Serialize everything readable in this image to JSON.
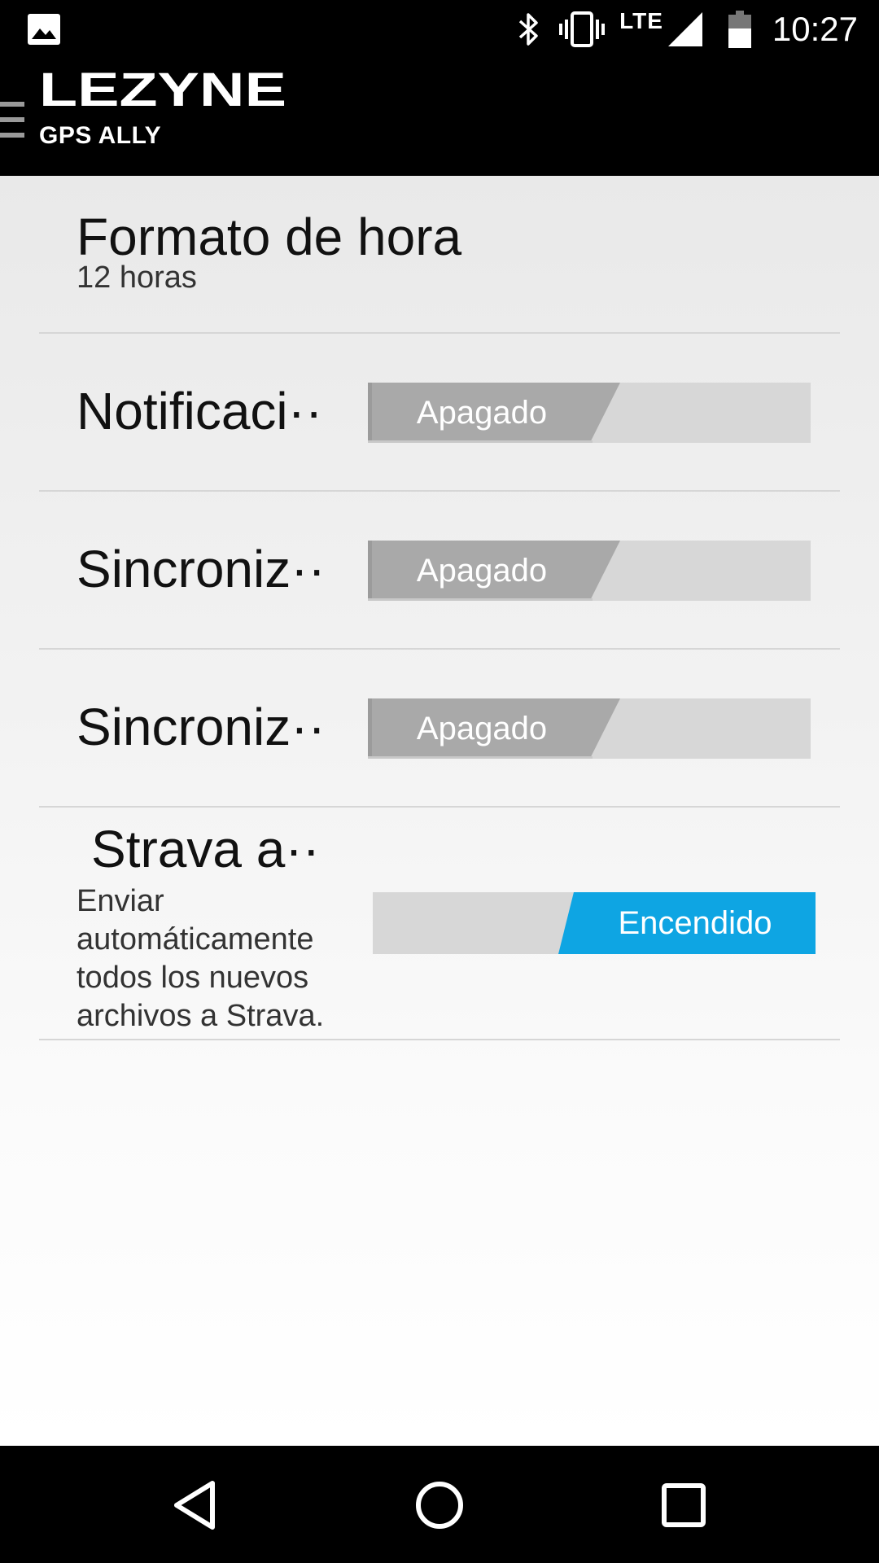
{
  "status_bar": {
    "time": "10:27",
    "network": "LTE",
    "icons": [
      "gallery-icon",
      "bluetooth-icon",
      "vibrate-icon",
      "signal-icon",
      "battery-icon"
    ]
  },
  "header": {
    "brand": "LEZYNE",
    "subtitle": "GPS ALLY",
    "menu_icon": "hamburger-menu-icon"
  },
  "settings": {
    "time_format": {
      "title": "Formato de hora",
      "value": "12 horas"
    },
    "notifications": {
      "title": "Notificaci··",
      "state": "Apagado"
    },
    "sync_1": {
      "title": "Sincroniz··",
      "state": "Apagado"
    },
    "sync_2": {
      "title": "Sincroniz··",
      "state": "Apagado"
    },
    "strava": {
      "title": "Strava a··",
      "description": "Enviar automáticamente todos los nuevos archivos a Strava.",
      "state": "Encendido"
    }
  },
  "colors": {
    "accent_on": "#0ea5e3",
    "toggle_off": "#a9a9a9",
    "toggle_track": "#d7d7d7"
  },
  "nav_bar": {
    "icons": [
      "back-icon",
      "home-icon",
      "recents-icon"
    ]
  }
}
